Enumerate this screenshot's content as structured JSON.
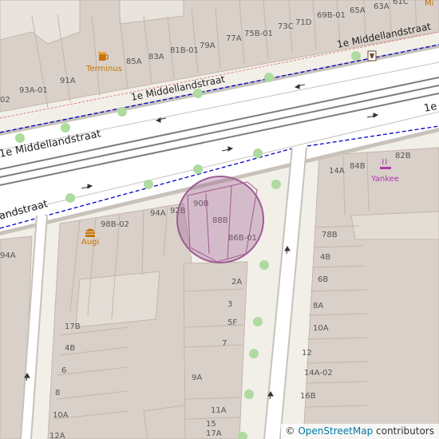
{
  "streets": [
    {
      "name": "1e Middellandstraat",
      "role": "north-service-road"
    },
    {
      "name": "1e Middellandstraat",
      "role": "main-road-west"
    },
    {
      "name": "1e Middellandstraat",
      "role": "main-road-east-truncated"
    },
    {
      "name": "andstraat",
      "role": "south-service-road-truncated"
    }
  ],
  "pois": [
    {
      "name": "Terminus",
      "icon": "beer-mug-icon",
      "color": "#c77400"
    },
    {
      "name": "Augi",
      "icon": "fast-food-icon",
      "color": "#c77400"
    },
    {
      "name": "Yankee",
      "icon": "smoking-shop-icon",
      "color": "#ac39ac"
    },
    {
      "name": "Mi",
      "icon": "",
      "color": "#c77400"
    }
  ],
  "house_numbers": [
    "93A-01",
    "91A",
    "85A",
    "83A",
    "81B-01",
    "79A",
    "77A",
    "75B-01",
    "73C",
    "71D",
    "69B-01",
    "65A",
    "63A",
    "61C",
    "02",
    "90B",
    "88B",
    "86B-01",
    "92B",
    "94A",
    "98B-02",
    "2A",
    "3",
    "5F",
    "7",
    "9A",
    "11A",
    "15",
    "17A",
    "17B",
    "4B",
    "6",
    "8",
    "10A",
    "12A",
    "14A",
    "84B",
    "82B",
    "78B",
    "4B",
    "6B",
    "8A",
    "10A",
    "12",
    "14A-02",
    "16B",
    "18B"
  ],
  "highlight_circle": {
    "color": "#9e5c92"
  },
  "colors": {
    "building": "#d9d0c9",
    "building_edge": "#c4b6ab",
    "road": "#ffffff",
    "casing": "#c8c2bb",
    "tram": "#7d7d7d",
    "route": "#0000c8",
    "tree": "#aedba0"
  },
  "attribution": {
    "symbol": "©",
    "link_text": "OpenStreetMap",
    "suffix": "contributors"
  }
}
